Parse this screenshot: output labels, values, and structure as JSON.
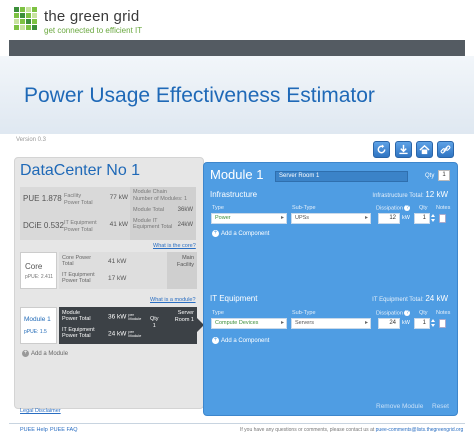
{
  "brand": {
    "name": "the green grid",
    "tagline": "get connected to efficient IT"
  },
  "page_title": "Power Usage Effectiveness Estimator",
  "version": "Version 0.3",
  "toolbar": {
    "icons": [
      "refresh-icon",
      "download-icon",
      "home-icon",
      "link-icon"
    ]
  },
  "datacenter": {
    "name": "DataCenter No 1",
    "summary": {
      "pue_label": "PUE",
      "pue_value": "1.878",
      "pue_desc_1": "Facility",
      "pue_desc_2": "Power Total",
      "pue_power": "77 kW",
      "dcie_label": "DCiE",
      "dcie_value": "0.532",
      "dcie_desc_1": "IT Equipment",
      "dcie_desc_2": "Power Total",
      "dcie_power": "41 kW",
      "right_label_1": "Module Chain",
      "right_label_2": "Number of Modules: 1",
      "right_label_3": "Module Total",
      "right_value_3": "36kW",
      "right_label_4a": "Module IT",
      "right_label_4b": "Equipment Total",
      "right_value_4": "24kW"
    },
    "what_is_core": "What is the core?",
    "core": {
      "name": "Core",
      "pue": "pPUE: 2.411",
      "row1_label_a": "Core Power",
      "row1_label_b": "Total",
      "row1_value": "41 kW",
      "row2_label_a": "IT Equipment",
      "row2_label_b": "Power Total",
      "row2_value": "17 kW",
      "right_a": "Main",
      "right_b": "Facility"
    },
    "what_is_module": "What is a module?",
    "module": {
      "name": "Module 1",
      "pue": "pPUE: 1.5",
      "row1_label_a": "Module",
      "row1_label_b": "Power Total",
      "row1_value": "36 kW",
      "row1_small_a": "per",
      "row1_small_b": "Module",
      "row2_label_a": "IT Equipment",
      "row2_label_b": "Power Total",
      "row2_value": "24 kW",
      "row2_small_a": "per",
      "row2_small_b": "Module",
      "qty_label": "Qty",
      "qty_value": "1",
      "right_a": "Server",
      "right_b": "Room 1"
    },
    "add_module": "Add a Module",
    "legal": "Legal Disclaimer"
  },
  "module_editor": {
    "title": "Module 1",
    "name_value": "Server Room 1",
    "qty_label": "Qty",
    "qty_value": "1",
    "infrastructure": {
      "title": "Infrastructure",
      "total_label": "Infrastructure Total:",
      "total_value": "12 kW",
      "col_type": "Type",
      "col_subtype": "Sub-Type",
      "col_dissipation": "Dissipation",
      "col_qty": "Qty",
      "col_notes": "Notes",
      "help": "?",
      "type_value": "Power",
      "subtype_value": "UPSs",
      "dissipation_value": "12",
      "unit": "kW",
      "qty_value": "1",
      "add_component": "Add a Component"
    },
    "it_equipment": {
      "title": "IT Equipment",
      "total_label": "IT Equipment Total:",
      "total_value": "24 kW",
      "col_type": "Type",
      "col_subtype": "Sub-Type",
      "col_dissipation": "Dissipation",
      "col_qty": "Qty",
      "col_notes": "Notes",
      "help": "?",
      "type_value": "Compute Devices",
      "subtype_value": "Servers",
      "dissipation_value": "24",
      "unit": "kW",
      "qty_value": "1",
      "add_component": "Add a Component"
    },
    "remove_module": "Remove Module",
    "reset": "Reset"
  },
  "footer": {
    "help": "PUEE Help",
    "faq": "PUEE FAQ",
    "contact_text": "If you have any questions or comments, please contact us at",
    "contact_email": "puee-comments@lists.thegreengrid.org"
  },
  "colors": {
    "accent_blue": "#1f69b7",
    "panel_blue": "#4f9de3",
    "brand_green": "#7dc242",
    "dark_bar": "#545b62"
  }
}
